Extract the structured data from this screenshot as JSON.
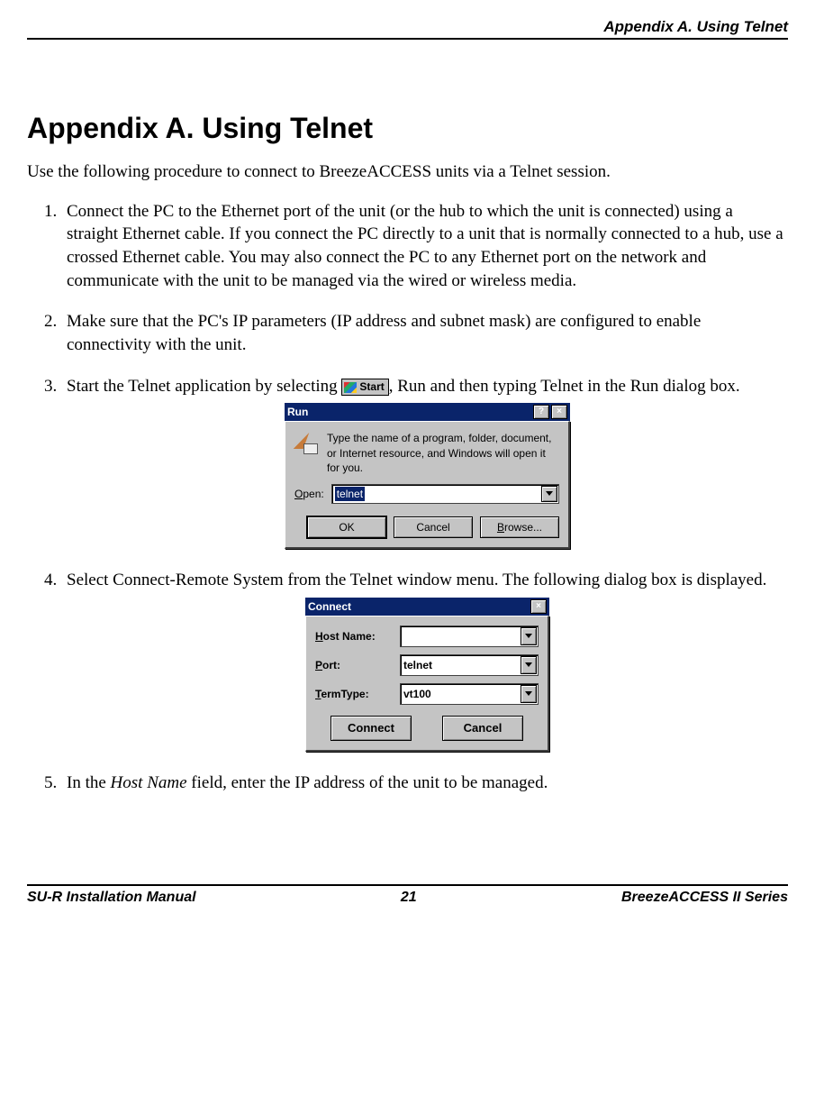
{
  "header": {
    "right": "Appendix A. Using Telnet"
  },
  "title": "Appendix A. Using Telnet",
  "intro": "Use the following procedure to connect to BreezeACCESS units via a Telnet session.",
  "steps": {
    "s1": "Connect the PC to the Ethernet port of the unit (or the hub to which the unit is connected) using a straight Ethernet cable. If you connect the PC directly to a unit that is normally connected to a hub, use a crossed Ethernet cable. You may also connect the PC to any Ethernet port on the network and communicate with the unit to be managed via the wired or wireless media.",
    "s2": "Make sure that the PC's IP parameters (IP address and subnet mask) are configured to enable connectivity with the unit.",
    "s3a": "Start the Telnet application by selecting ",
    "start_label": "Start",
    "s3b": ", Run and then typing Telnet in the Run dialog box.",
    "s4": "Select Connect-Remote System from the Telnet window menu. The following dialog box is displayed.",
    "s5a": "In the ",
    "s5_field": "Host Name",
    "s5b": " field, enter the IP address of the unit to be managed."
  },
  "run_dialog": {
    "title": "Run",
    "help_btn": "?",
    "close_btn": "×",
    "message": "Type the name of a program, folder, document, or Internet resource, and Windows will open it for you.",
    "open_label_u": "O",
    "open_label_rest": "pen:",
    "value": "telnet",
    "ok": "OK",
    "cancel": "Cancel",
    "browse_u": "B",
    "browse_rest": "rowse..."
  },
  "connect_dialog": {
    "title": "Connect",
    "close_btn": "×",
    "host_u": "H",
    "host_rest": "ost Name:",
    "host_value": "",
    "port_u": "P",
    "port_rest": "ort:",
    "port_value": "telnet",
    "term_u": "T",
    "term_rest": "ermType:",
    "term_value": "vt100",
    "connect_u": "C",
    "connect_rest": "onnect",
    "cancel": "Cancel"
  },
  "footer": {
    "left": "SU-R Installation Manual",
    "center": "21",
    "right": "BreezeACCESS II Series"
  }
}
